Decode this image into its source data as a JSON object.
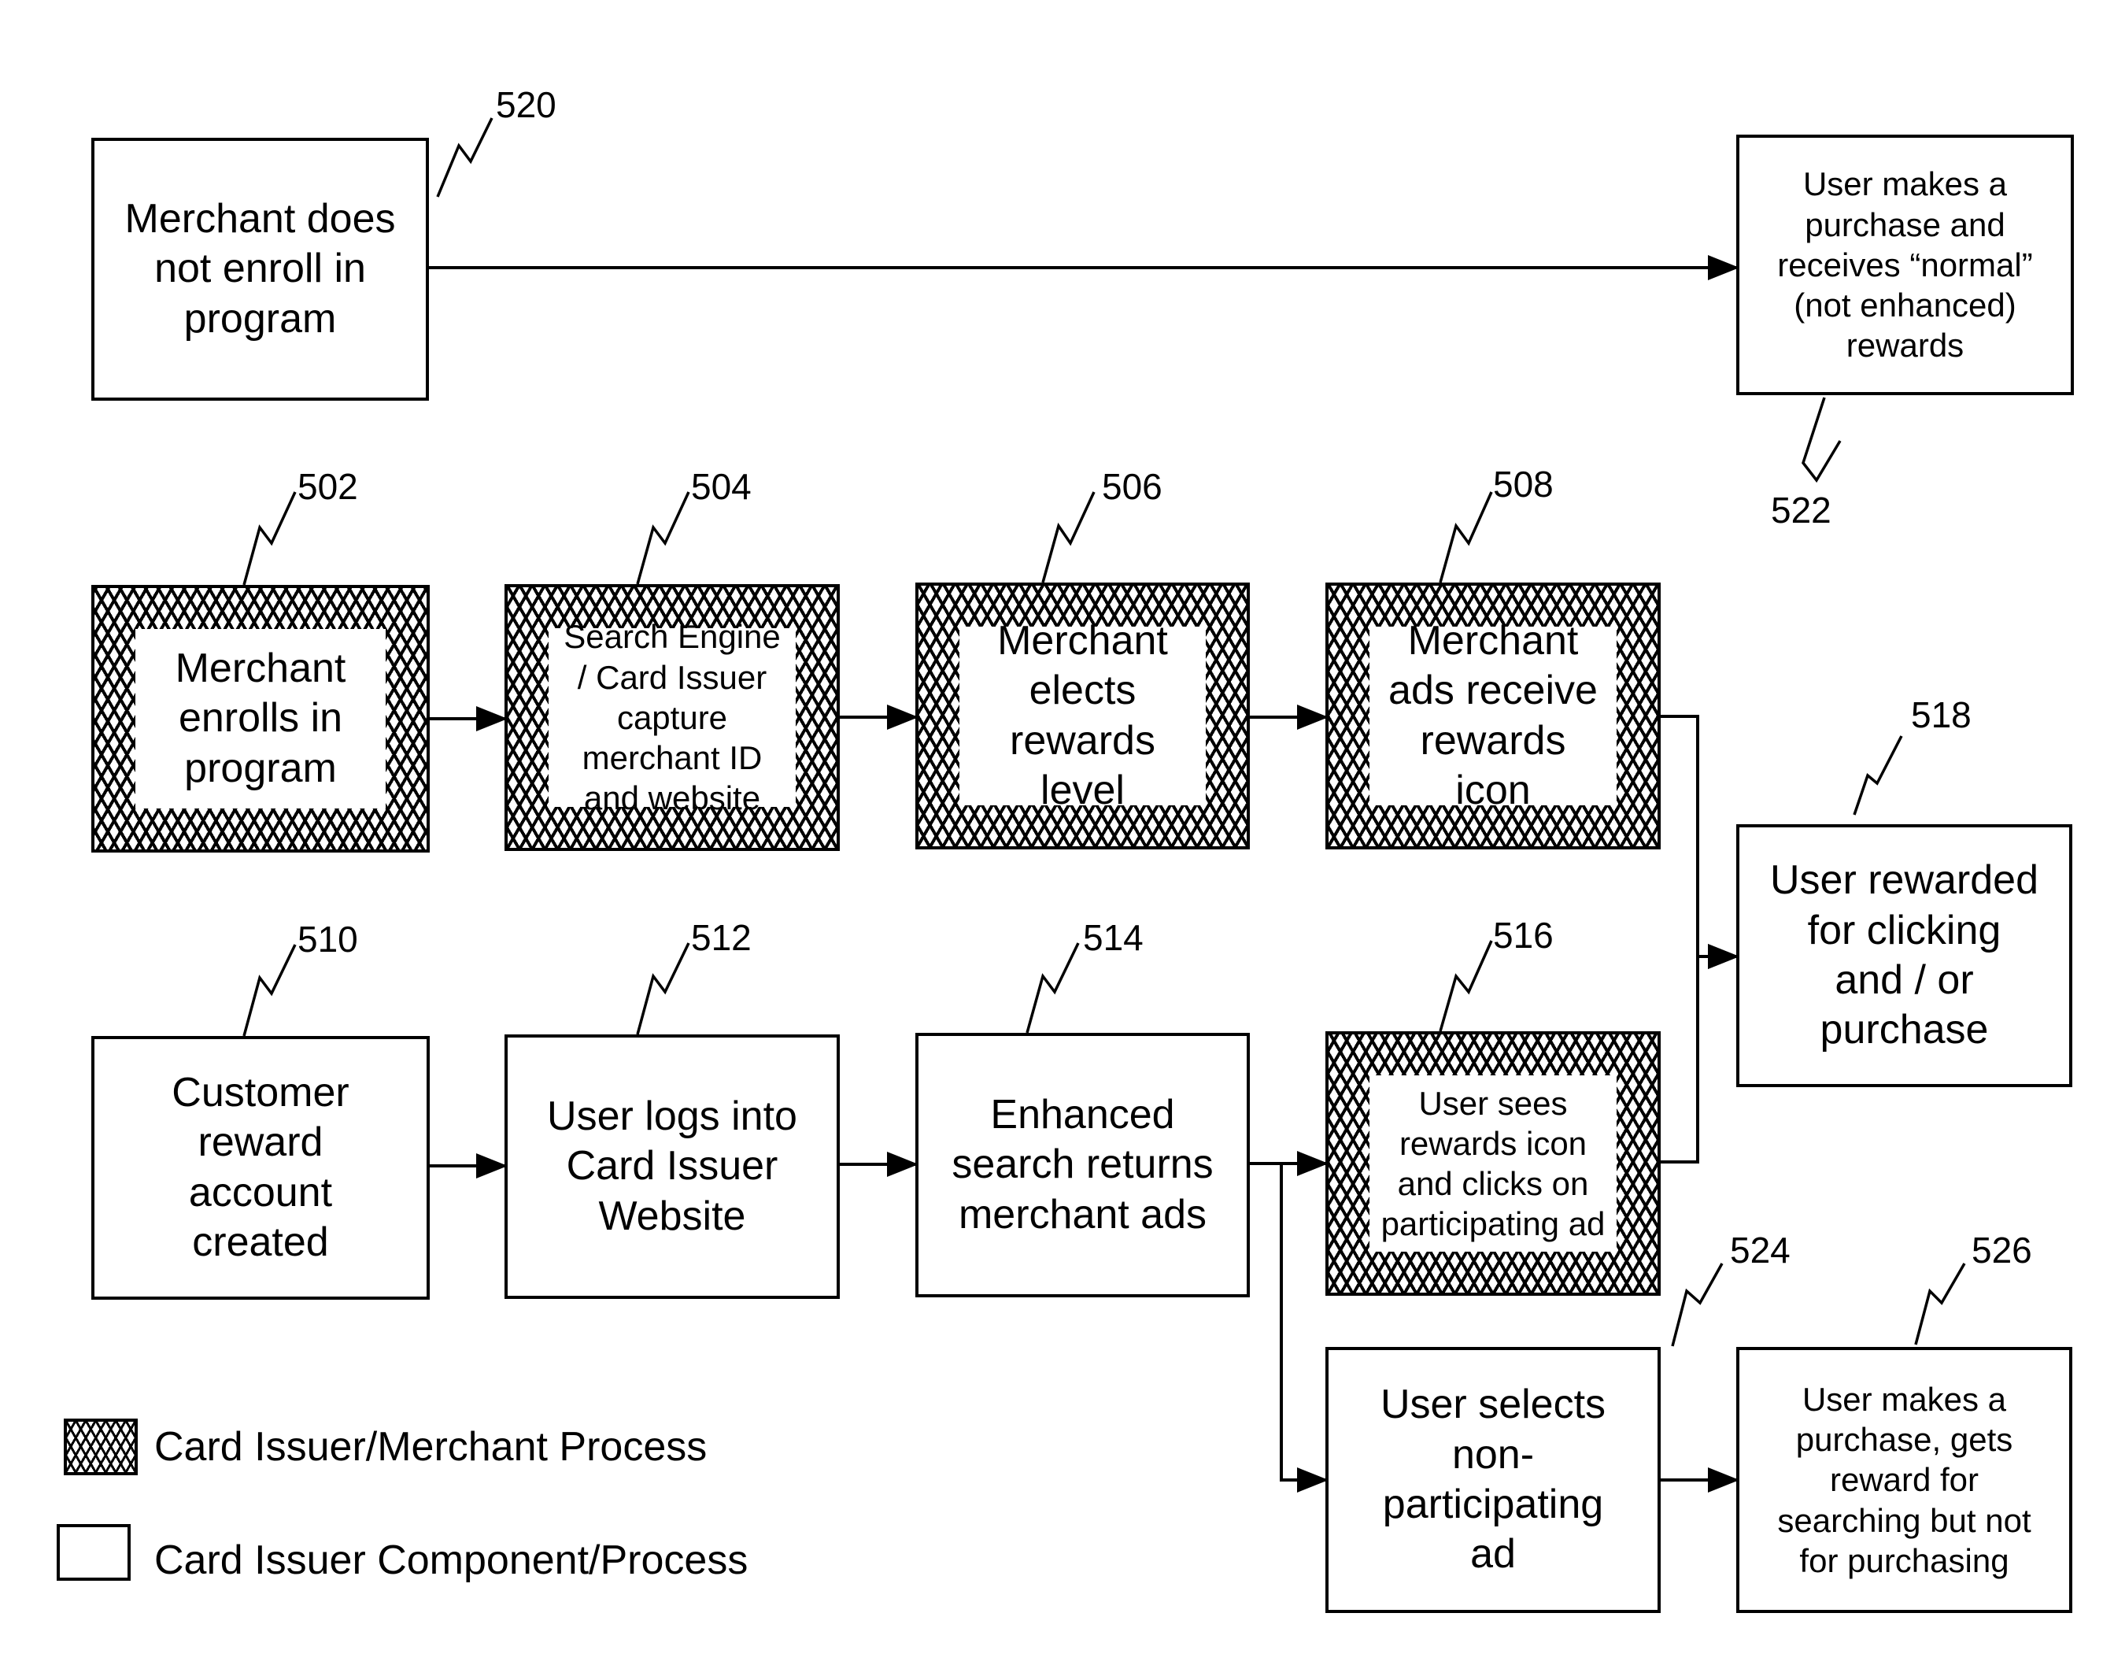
{
  "figure": {
    "nodes": [
      {
        "id": "520",
        "ref": "520",
        "text": "Merchant does\nnot enroll in\nprogram",
        "style": "plain"
      },
      {
        "id": "522",
        "ref": "522",
        "text": "User makes a\npurchase and\nreceives “normal”\n(not enhanced)\nrewards",
        "style": "plain"
      },
      {
        "id": "502",
        "ref": "502",
        "text": "Merchant\nenrolls in\nprogram",
        "style": "hatched"
      },
      {
        "id": "504",
        "ref": "504",
        "text": "Search Engine\n/ Card Issuer\ncapture\nmerchant ID\nand website",
        "style": "hatched"
      },
      {
        "id": "506",
        "ref": "506",
        "text": "Merchant\nelects\nrewards\nlevel",
        "style": "hatched"
      },
      {
        "id": "508",
        "ref": "508",
        "text": "Merchant\nads receive\nrewards\nicon",
        "style": "hatched"
      },
      {
        "id": "518",
        "ref": "518",
        "text": "User rewarded\nfor clicking\nand / or\npurchase",
        "style": "plain"
      },
      {
        "id": "510",
        "ref": "510",
        "text": "Customer\nreward\naccount\ncreated",
        "style": "plain"
      },
      {
        "id": "512",
        "ref": "512",
        "text": "User logs into\nCard Issuer\nWebsite",
        "style": "plain"
      },
      {
        "id": "514",
        "ref": "514",
        "text": "Enhanced\nsearch returns\nmerchant ads",
        "style": "plain"
      },
      {
        "id": "516",
        "ref": "516",
        "text": "User sees\nrewards icon\nand clicks on\nparticipating ad",
        "style": "hatched"
      },
      {
        "id": "524",
        "ref": "524",
        "text": "User selects\nnon-\nparticipating\nad",
        "style": "plain"
      },
      {
        "id": "526",
        "ref": "526",
        "text": "User makes a\npurchase, gets\nreward for\nsearching but not\nfor purchasing",
        "style": "plain"
      }
    ],
    "edges": [
      {
        "from": "520",
        "to": "522"
      },
      {
        "from": "502",
        "to": "504"
      },
      {
        "from": "504",
        "to": "506"
      },
      {
        "from": "506",
        "to": "508"
      },
      {
        "from": "508",
        "to": "518"
      },
      {
        "from": "516",
        "to": "518"
      },
      {
        "from": "510",
        "to": "512"
      },
      {
        "from": "512",
        "to": "514"
      },
      {
        "from": "514",
        "to": "516"
      },
      {
        "from": "514",
        "to": "524"
      },
      {
        "from": "524",
        "to": "526"
      }
    ],
    "legend": [
      {
        "style": "hatched",
        "label": "Card Issuer/Merchant Process"
      },
      {
        "style": "plain",
        "label": "Card Issuer Component/Process"
      }
    ]
  }
}
